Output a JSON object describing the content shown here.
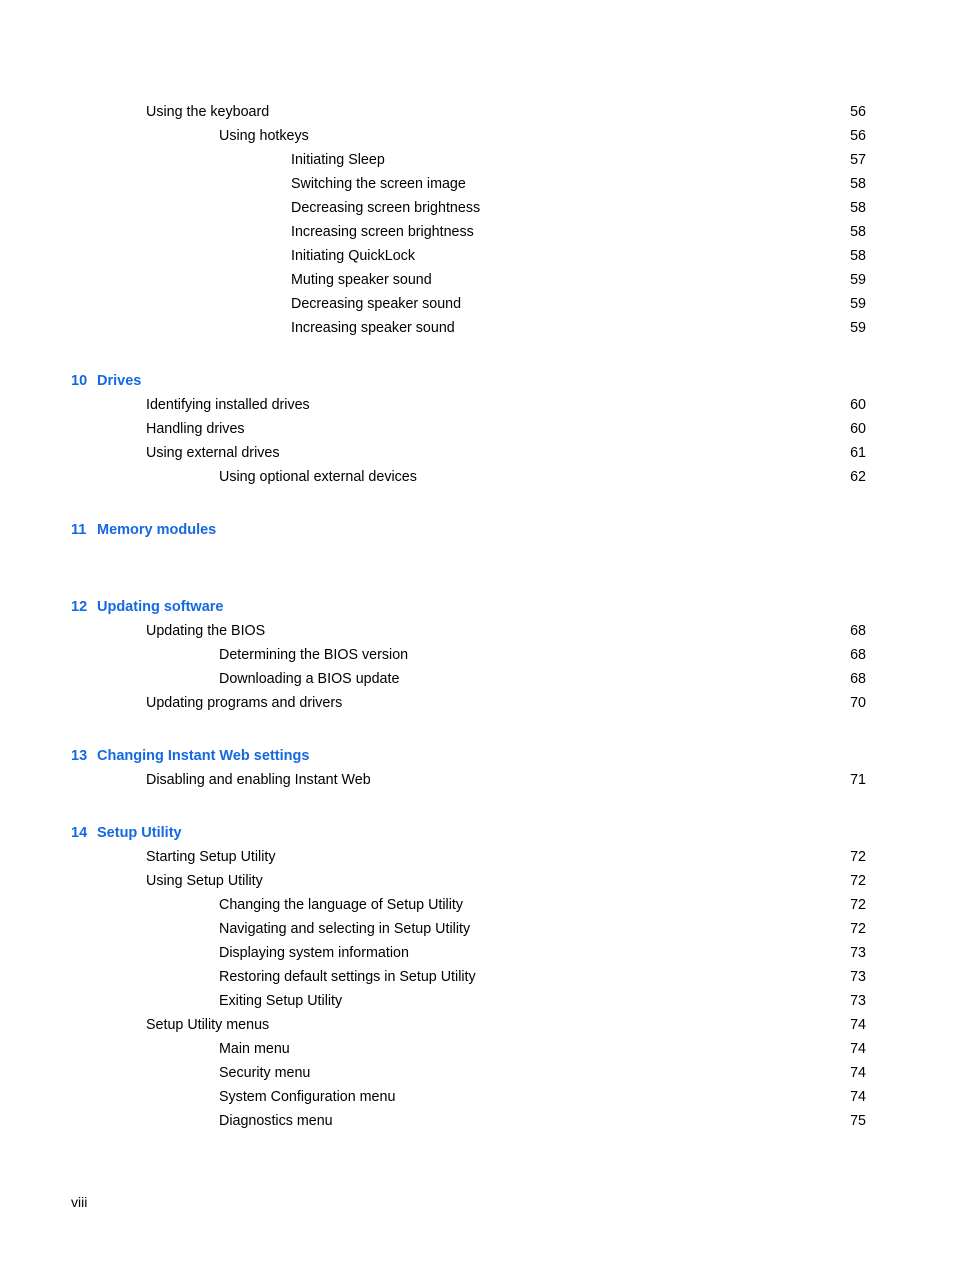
{
  "document": {
    "type": "table-of-contents",
    "page_label": "viii",
    "accent_color": "#1569e0",
    "text_color": "#000000",
    "background_color": "#ffffff"
  },
  "toc": {
    "blocks": [
      {
        "kind": "entries",
        "entries": [
          {
            "level": 1,
            "title": "Using the keyboard",
            "page": "56"
          },
          {
            "level": 2,
            "title": "Using hotkeys",
            "page": "56"
          },
          {
            "level": 3,
            "title": "Initiating Sleep",
            "page": "57"
          },
          {
            "level": 3,
            "title": "Switching the screen image",
            "page": "58"
          },
          {
            "level": 3,
            "title": "Decreasing screen brightness",
            "page": "58"
          },
          {
            "level": 3,
            "title": "Increasing screen brightness",
            "page": "58"
          },
          {
            "level": 3,
            "title": "Initiating QuickLock",
            "page": "58"
          },
          {
            "level": 3,
            "title": "Muting speaker sound",
            "page": "59"
          },
          {
            "level": 3,
            "title": "Decreasing speaker sound",
            "page": "59"
          },
          {
            "level": 3,
            "title": "Increasing speaker sound",
            "page": "59"
          }
        ]
      },
      {
        "kind": "chapter",
        "number": "10",
        "title": "Drives",
        "entries": [
          {
            "level": 1,
            "title": "Identifying installed drives",
            "page": "60"
          },
          {
            "level": 1,
            "title": "Handling drives",
            "page": "60"
          },
          {
            "level": 1,
            "title": "Using external drives",
            "page": "61"
          },
          {
            "level": 2,
            "title": "Using optional external devices",
            "page": "62"
          }
        ]
      },
      {
        "kind": "chapter",
        "number": "11",
        "title": "Memory modules",
        "entries": []
      },
      {
        "kind": "chapter",
        "number": "12",
        "title": "Updating software",
        "entries": [
          {
            "level": 1,
            "title": "Updating the BIOS",
            "page": "68"
          },
          {
            "level": 2,
            "title": "Determining the BIOS version",
            "page": "68"
          },
          {
            "level": 2,
            "title": "Downloading a BIOS update",
            "page": "68"
          },
          {
            "level": 1,
            "title": "Updating programs and drivers",
            "page": "70"
          }
        ]
      },
      {
        "kind": "chapter",
        "number": "13",
        "title": "Changing Instant Web settings",
        "entries": [
          {
            "level": 1,
            "title": "Disabling and enabling Instant Web",
            "page": "71"
          }
        ]
      },
      {
        "kind": "chapter",
        "number": "14",
        "title": "Setup Utility",
        "entries": [
          {
            "level": 1,
            "title": "Starting Setup Utility",
            "page": "72"
          },
          {
            "level": 1,
            "title": "Using Setup Utility",
            "page": "72"
          },
          {
            "level": 2,
            "title": "Changing the language of Setup Utility",
            "page": "72"
          },
          {
            "level": 2,
            "title": "Navigating and selecting in Setup Utility",
            "page": "72"
          },
          {
            "level": 2,
            "title": "Displaying system information",
            "page": "73"
          },
          {
            "level": 2,
            "title": "Restoring default settings in Setup Utility",
            "page": "73"
          },
          {
            "level": 2,
            "title": "Exiting Setup Utility",
            "page": "73"
          },
          {
            "level": 1,
            "title": "Setup Utility menus",
            "page": "74"
          },
          {
            "level": 2,
            "title": "Main menu",
            "page": "74"
          },
          {
            "level": 2,
            "title": "Security menu",
            "page": "74"
          },
          {
            "level": 2,
            "title": "System Configuration menu",
            "page": "74"
          },
          {
            "level": 2,
            "title": "Diagnostics menu",
            "page": "75"
          }
        ]
      }
    ]
  }
}
